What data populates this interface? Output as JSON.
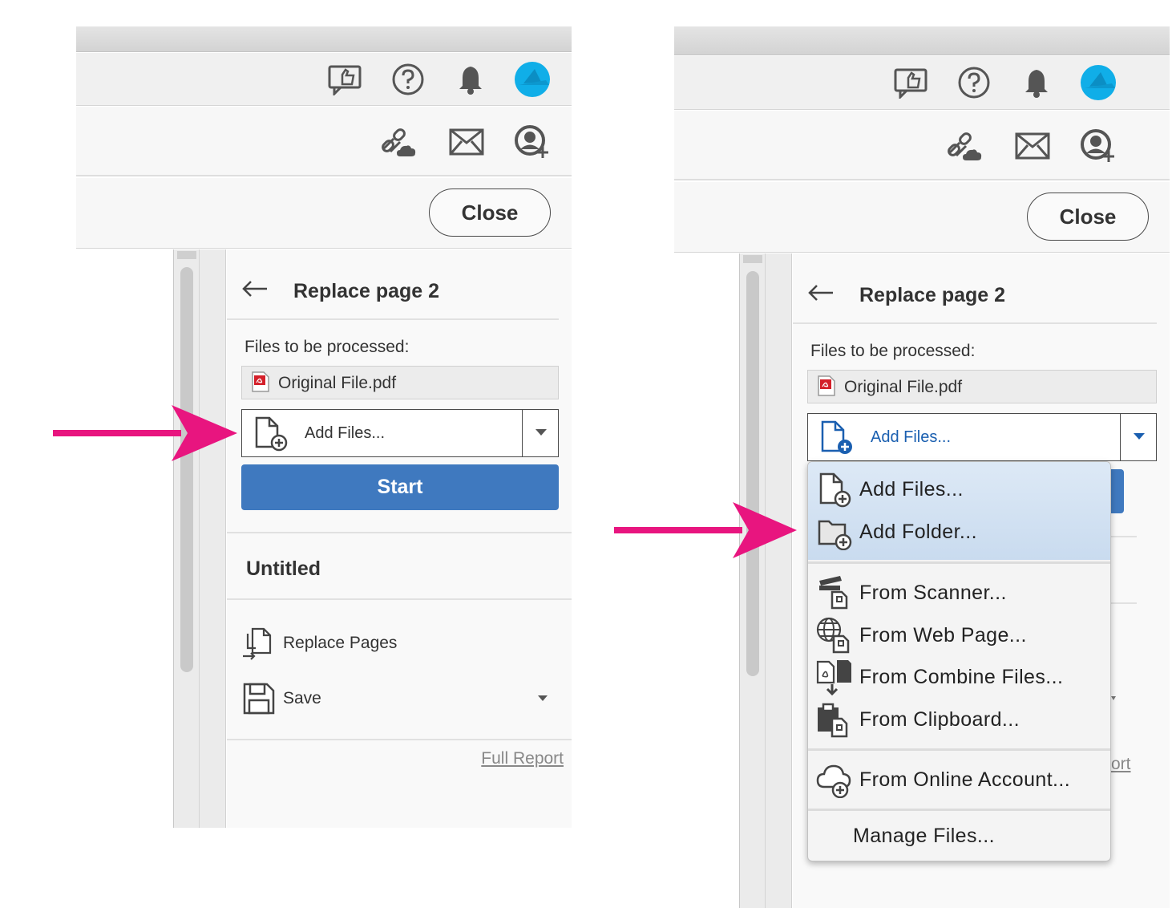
{
  "left_panel": {
    "close_label": "Close",
    "replace_title": "Replace page 2",
    "files_label": "Files to be processed:",
    "file_name": "Original File.pdf",
    "add_files_label": "Add Files...",
    "start_label": "Start",
    "untitled": "Untitled",
    "replace_pages": "Replace Pages",
    "save": "Save",
    "full_report": "Full Report"
  },
  "right_panel": {
    "close_label": "Close",
    "replace_title": "Replace page 2",
    "files_label": "Files to be processed:",
    "file_name": "Original File.pdf",
    "add_files_label": "Add Files...",
    "partial_report": "ort"
  },
  "menu": {
    "items": [
      {
        "label": "Add Files...",
        "icon": "file-add-icon"
      },
      {
        "label": "Add Folder...",
        "icon": "folder-add-icon"
      },
      {
        "label": "From Scanner...",
        "icon": "scanner-icon"
      },
      {
        "label": "From Web Page...",
        "icon": "globe-icon"
      },
      {
        "label": "From Combine Files...",
        "icon": "combine-files-icon"
      },
      {
        "label": "From Clipboard...",
        "icon": "clipboard-icon"
      },
      {
        "label": "From Online Account...",
        "icon": "cloud-add-icon"
      },
      {
        "label": "Manage Files...",
        "icon": ""
      }
    ]
  },
  "colors": {
    "accent_blue": "#3f79bf",
    "arrow_magenta": "#e8157f",
    "avatar_cyan": "#10aee8",
    "menu_highlight": "#c9dbef"
  }
}
